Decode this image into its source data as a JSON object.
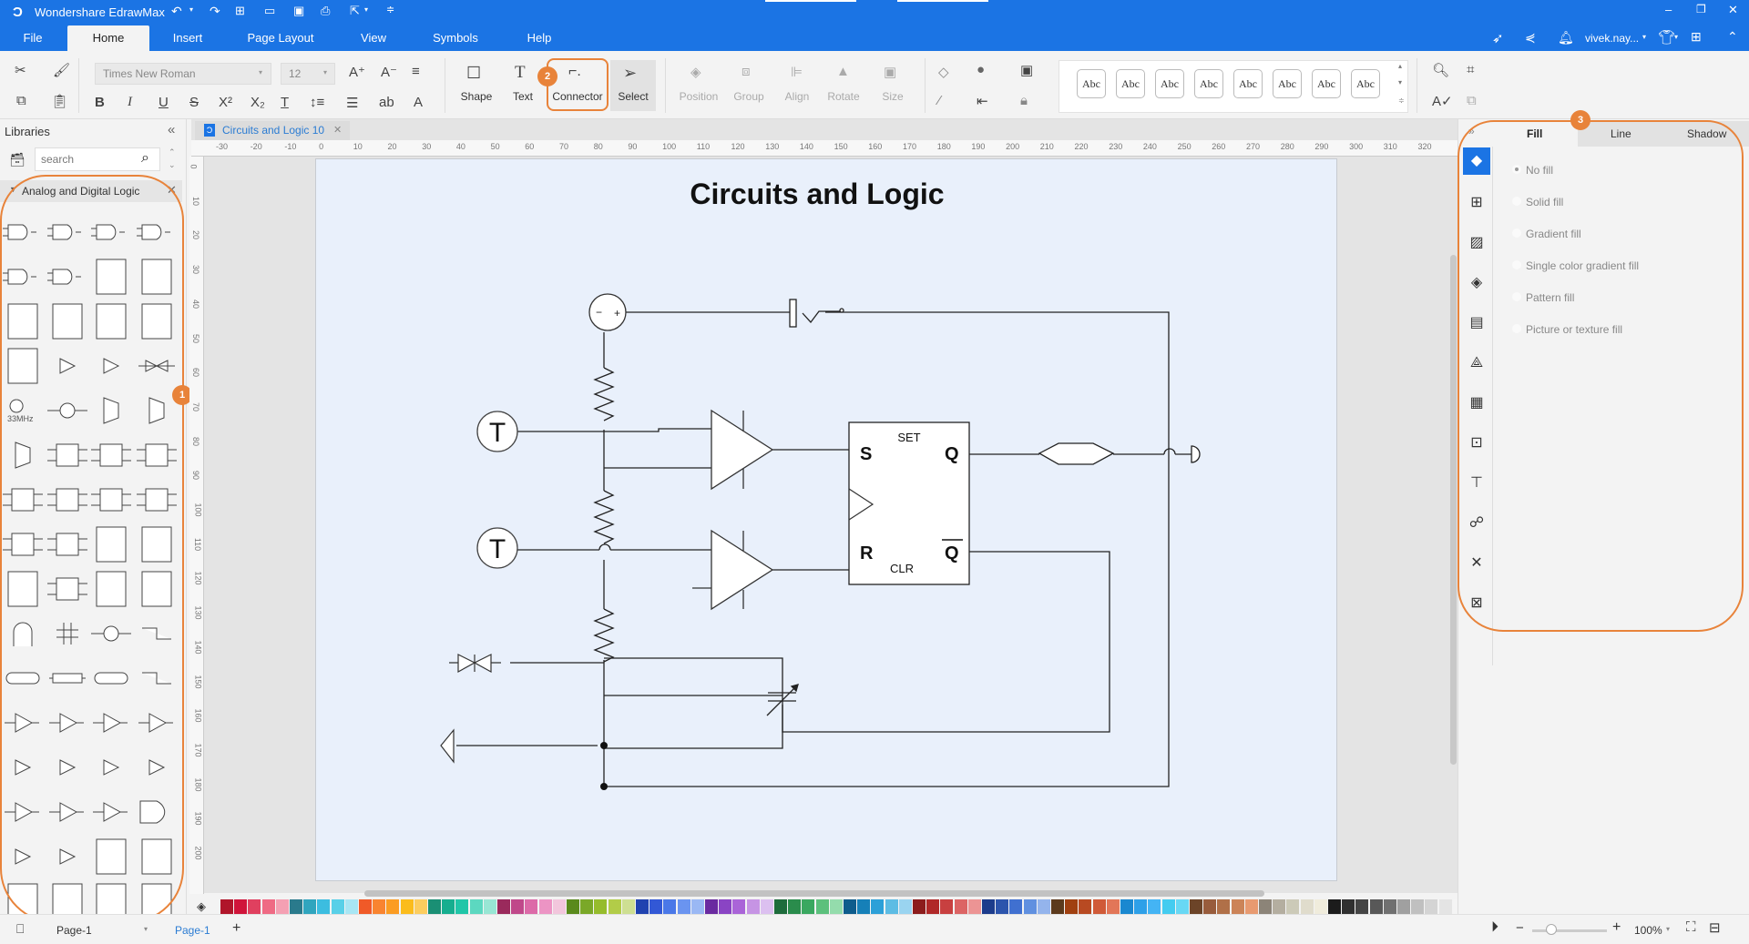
{
  "app": {
    "title": "Wondershare EdrawMax"
  },
  "window_controls": {
    "minimize": "–",
    "restore": "❐",
    "close": "✕"
  },
  "menu": {
    "items": [
      {
        "label": "File"
      },
      {
        "label": "Home"
      },
      {
        "label": "Insert"
      },
      {
        "label": "Page Layout"
      },
      {
        "label": "View"
      },
      {
        "label": "Symbols"
      },
      {
        "label": "Help"
      }
    ],
    "active": "Home"
  },
  "user": {
    "name": "vivek.nay..."
  },
  "ribbon": {
    "font_family": "Times New Roman",
    "font_size": "12",
    "tools": [
      {
        "label": "Shape",
        "icon": "rectangle-icon"
      },
      {
        "label": "Text",
        "icon": "text-icon"
      },
      {
        "label": "Connector",
        "icon": "connector-icon"
      },
      {
        "label": "Select",
        "icon": "cursor-icon"
      }
    ],
    "arrange": [
      {
        "label": "Position"
      },
      {
        "label": "Group"
      },
      {
        "label": "Align"
      },
      {
        "label": "Rotate"
      },
      {
        "label": "Size"
      }
    ],
    "styles": [
      "Abc",
      "Abc",
      "Abc",
      "Abc",
      "Abc",
      "Abc",
      "Abc",
      "Abc"
    ]
  },
  "badges": {
    "one": "1",
    "two": "2",
    "three": "3"
  },
  "libraries": {
    "title": "Libraries",
    "search_placeholder": "search",
    "category": "Analog and Digital Logic",
    "clock_label": "33MHz"
  },
  "document": {
    "tab": "Circuits and Logic 10",
    "diagram_title": "Circuits and Logic",
    "flipflop": {
      "set": "SET",
      "clr": "CLR",
      "s": "S",
      "r": "R",
      "q": "Q",
      "qbar": "Q"
    },
    "thermistor_label": "T"
  },
  "ruler": {
    "top": [
      "-30",
      "-20",
      "-10",
      "0",
      "10",
      "20",
      "30",
      "40",
      "50",
      "60",
      "70",
      "80",
      "90",
      "100",
      "110",
      "120",
      "130",
      "140",
      "150",
      "160",
      "170",
      "180",
      "190",
      "200",
      "210",
      "220",
      "230",
      "240",
      "250",
      "260",
      "270",
      "280",
      "290",
      "300",
      "310",
      "320"
    ],
    "left": [
      "0",
      "10",
      "20",
      "30",
      "40",
      "50",
      "60",
      "70",
      "80",
      "90",
      "100",
      "110",
      "120",
      "130",
      "140",
      "150",
      "160",
      "170",
      "180",
      "190",
      "200"
    ]
  },
  "format_panel": {
    "tabs": [
      {
        "label": "Fill"
      },
      {
        "label": "Line"
      },
      {
        "label": "Shadow"
      }
    ],
    "active_tab": "Fill",
    "fill_options": [
      {
        "label": "No fill",
        "selected": true
      },
      {
        "label": "Solid fill",
        "selected": false
      },
      {
        "label": "Gradient fill",
        "selected": false
      },
      {
        "label": "Single color gradient fill",
        "selected": false
      },
      {
        "label": "Pattern fill",
        "selected": false
      },
      {
        "label": "Picture or texture fill",
        "selected": false
      }
    ]
  },
  "palette": [
    "#b0152a",
    "#d0143a",
    "#e0405f",
    "#ef6a84",
    "#f4a0b3",
    "#2a7a8c",
    "#30a5be",
    "#3cbde0",
    "#58d0e8",
    "#a8e6f4",
    "#f05a28",
    "#f98430",
    "#fb9c22",
    "#fbbc1c",
    "#fccd5e",
    "#1a8f74",
    "#16ae8f",
    "#20c6a8",
    "#5cd8c0",
    "#98e6d4",
    "#9a2a5c",
    "#c0488a",
    "#dc6aa8",
    "#ec94c4",
    "#f2c6dc",
    "#5a8a1c",
    "#7aa828",
    "#96bc2c",
    "#b2cc48",
    "#cedf92",
    "#2042b0",
    "#3258d6",
    "#4a78e8",
    "#6a94f0",
    "#9ab8f4",
    "#6a2aa0",
    "#8a44c4",
    "#aa64d8",
    "#c694e4",
    "#dcc0f0",
    "#1e6c3c",
    "#2a8c4c",
    "#3aa860",
    "#5cc07c",
    "#94dcac",
    "#0e5c8c",
    "#1680b8",
    "#2ca0d8",
    "#5cbce4",
    "#9ad4f0",
    "#8c1c1c",
    "#b02828",
    "#c84040",
    "#dc6464",
    "#ec9494",
    "#1c3c8c",
    "#2c54ac",
    "#4070d0",
    "#6090e0",
    "#94b4ec",
    "#5c3a1c",
    "#a04010",
    "#b84a22",
    "#d05a38",
    "#e27658",
    "#1a88d0",
    "#2ea0e8",
    "#44b4f4",
    "#44ccf0",
    "#68d8f4",
    "#6c4428",
    "#985c3c",
    "#b07048",
    "#cc8458",
    "#e89a70",
    "#8c8478",
    "#b4aea0",
    "#cccab8",
    "#e0dccc",
    "#f0ecdc",
    "#1c1c1c",
    "#303030",
    "#444444",
    "#585858",
    "#707070",
    "#a0a0a0",
    "#c0c0c0",
    "#d4d4d4",
    "#e4e4e4",
    "#f4f4f4",
    "#ffffff"
  ],
  "status": {
    "page_select": "Page-1",
    "page_tab": "Page-1",
    "zoom": "100%"
  }
}
